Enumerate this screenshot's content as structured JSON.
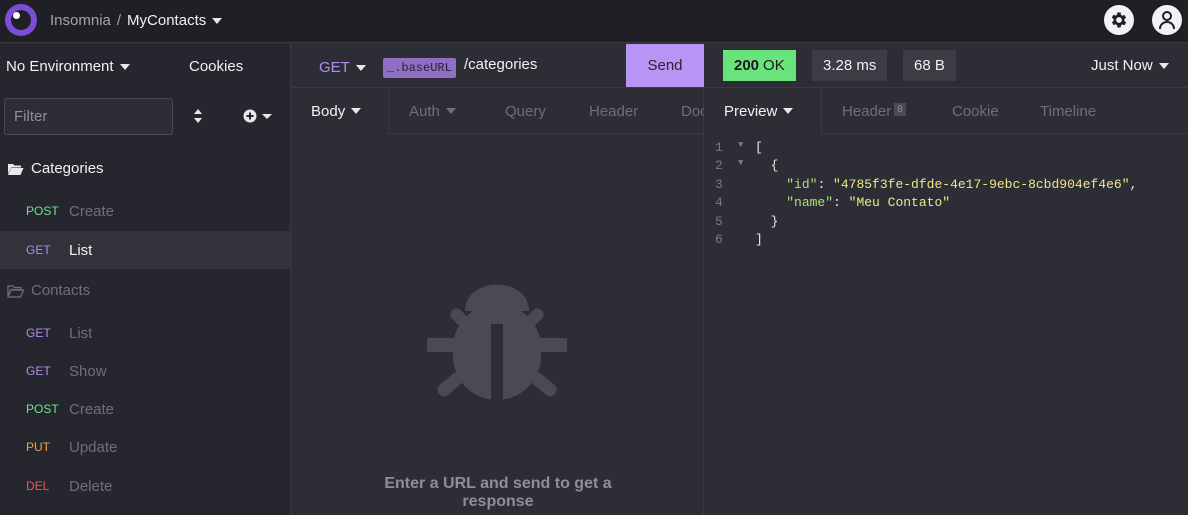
{
  "app": {
    "name": "Insomnia",
    "separator": "/",
    "workspace": "MyContacts"
  },
  "sidebar": {
    "environment": "No Environment",
    "cookies": "Cookies",
    "filter_placeholder": "Filter",
    "folders": [
      {
        "label": "Categories",
        "requests": [
          {
            "method": "POST",
            "name": "Create"
          },
          {
            "method": "GET",
            "name": "List"
          }
        ]
      },
      {
        "label": "Contacts",
        "requests": [
          {
            "method": "GET",
            "name": "List"
          },
          {
            "method": "GET",
            "name": "Show"
          },
          {
            "method": "POST",
            "name": "Create"
          },
          {
            "method": "PUT",
            "name": "Update"
          },
          {
            "method": "DEL",
            "name": "Delete"
          }
        ]
      }
    ]
  },
  "request": {
    "method": "GET",
    "base_variable": "_.baseURL",
    "path": "/categories",
    "send_label": "Send",
    "tabs": [
      "Body",
      "Auth",
      "Query",
      "Header",
      "Doc"
    ],
    "empty_message": "Enter a URL and send to get a response"
  },
  "response": {
    "status_code": "200",
    "status_text": "OK",
    "time": "3.28 ms",
    "size": "68 B",
    "history": "Just Now",
    "tabs": {
      "preview": "Preview",
      "header": "Header",
      "header_count": "8",
      "cookie": "Cookie",
      "timeline": "Timeline"
    },
    "body_lines": [
      {
        "n": "1",
        "fold": true,
        "text": "["
      },
      {
        "n": "2",
        "fold": true,
        "text": "  {"
      },
      {
        "n": "3",
        "fold": false,
        "key": "\"id\"",
        "value": "\"4785f3fe-dfde-4e17-9ebc-8cbd904ef4e6\"",
        "trail": ","
      },
      {
        "n": "4",
        "fold": false,
        "key": "\"name\"",
        "value": "\"Meu Contato\"",
        "trail": ""
      },
      {
        "n": "5",
        "fold": false,
        "text": "  }"
      },
      {
        "n": "6",
        "fold": false,
        "text": "]"
      }
    ]
  },
  "colors": {
    "accent": "#b895f5",
    "status_ok": "#69e37b",
    "method_post": "#6ee38a",
    "method_get": "#b18cf2",
    "method_put": "#f0a33c",
    "method_del": "#f25555"
  },
  "icons": {
    "logo": "insomnia-logo",
    "settings": "gear-icon",
    "account": "user-icon",
    "folder_open": "folder-open-icon",
    "empty_state": "bug-icon"
  }
}
